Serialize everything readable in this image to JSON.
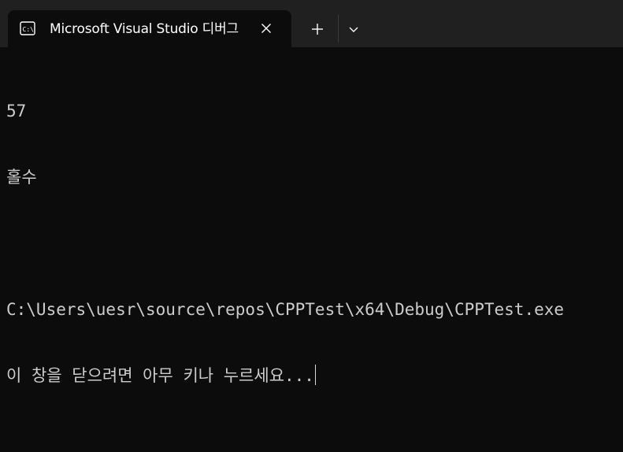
{
  "tab": {
    "title": "Microsoft Visual Studio 디버그",
    "icon": "console-icon",
    "close_icon": "close-icon"
  },
  "toolbar": {
    "new_tab_icon": "plus-icon",
    "dropdown_icon": "chevron-down-icon"
  },
  "terminal": {
    "lines": [
      "57",
      "홀수",
      "",
      "C:\\Users\\uesr\\source\\repos\\CPPTest\\x64\\Debug\\CPPTest.exe",
      "이 창을 닫으려면 아무 키나 누르세요..."
    ]
  },
  "colors": {
    "background": "#0c0c0c",
    "tabbar": "#202020",
    "text": "#cccccc"
  }
}
